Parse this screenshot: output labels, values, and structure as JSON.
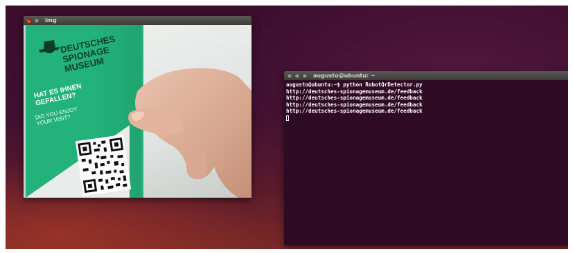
{
  "image_window": {
    "title": "img",
    "brochure_lines": [
      "DEUTSCHES",
      "SPIONAGE",
      "MUSEUM"
    ],
    "brochure_question": [
      "HAT ES IHNEN",
      "GEFALLEN?"
    ],
    "brochure_sub": [
      "DID YOU ENJOY",
      "YOUR VISIT?"
    ]
  },
  "terminal_window": {
    "title": "augusto@ubuntu: ~",
    "lines": [
      "augusto@ubuntu:~$ python RobotQrDetector.py",
      "http://deutsches-spionagemuseum.de/feedback",
      "http://deutsches-spionagemuseum.de/feedback",
      "http://deutsches-spionagemuseum.de/feedback",
      "http://deutsches-spionagemuseum.de/feedback"
    ]
  },
  "colors": {
    "accent": "#e8772d",
    "terminal_bg": "#2f0a24",
    "brochure_green": "#22b27a"
  }
}
